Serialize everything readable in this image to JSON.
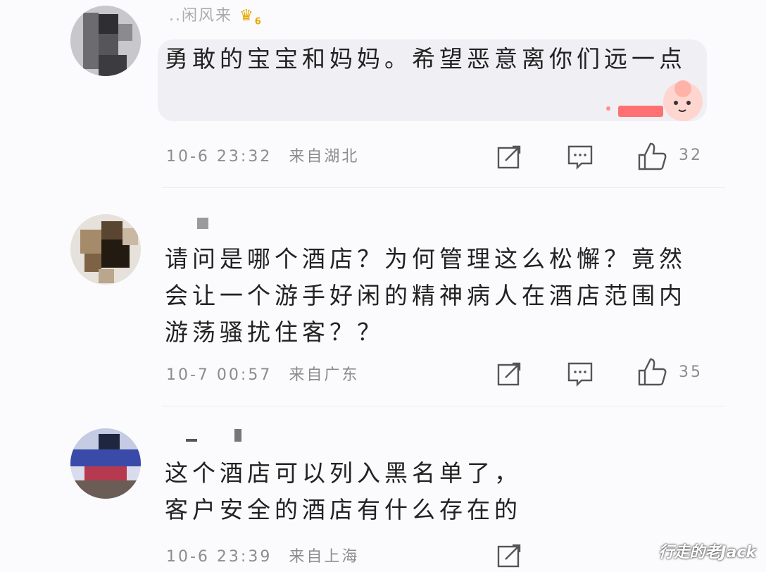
{
  "comments": [
    {
      "username": "..闲风来",
      "badge": "6",
      "content": "勇敢的宝宝和妈妈。希望恶意离你们远一点",
      "time": "10-6 23:32",
      "location": "来自湖北",
      "likes": "32"
    },
    {
      "username": "",
      "content": "请问是哪个酒店？为何管理这么松懈？竟然会让一个游手好闲的精神病人在酒店范围内游荡骚扰住客？？",
      "time": "10-7 00:57",
      "location": "来自广东",
      "likes": "35"
    },
    {
      "username": "",
      "content": "这个酒店可以列入黑名单了，客户安全的酒店有什么存在的",
      "time": "10-6 23:39",
      "location": "来自上海"
    }
  ],
  "icons": {
    "share": "share-icon",
    "reply": "comment-icon",
    "like": "thumbs-up-icon"
  },
  "watermark": "行走的老Jack",
  "colors": {
    "meta": "#8c8c8c",
    "badge": "#e8a800",
    "bubble": "#f0eff4"
  }
}
